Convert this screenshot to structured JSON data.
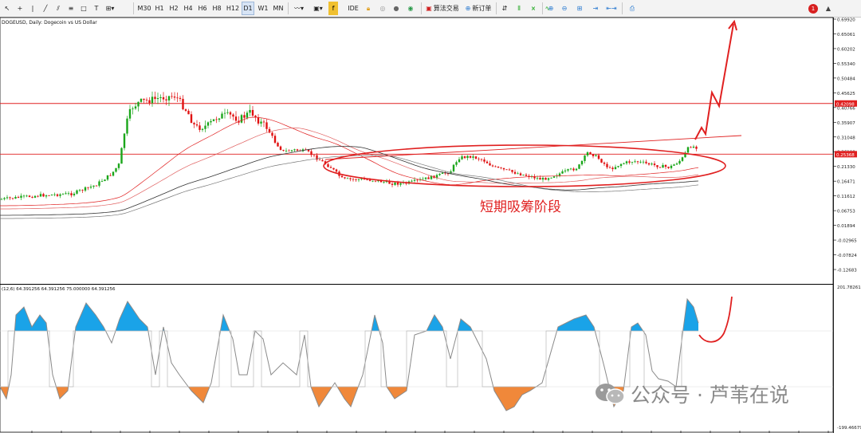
{
  "toolbar": {
    "timeframes": [
      "M30",
      "H1",
      "H2",
      "H4",
      "H6",
      "H8",
      "H12",
      "D1",
      "W1",
      "MN"
    ],
    "active_timeframe": "D1",
    "ide_label": "IDE",
    "algo_label": "算法交易",
    "new_order_label": "新订单",
    "notification_count": "1"
  },
  "chart": {
    "symbol_caption": "DOGEUSD, Daily: Dogecoin vs US Dollar",
    "annotation": "短期吸筹阶段",
    "price_labels": [
      "0.69920",
      "0.65061",
      "0.60202",
      "0.55340",
      "0.50484",
      "0.45625",
      "0.40766",
      "0.35907",
      "0.31048",
      "0.26190",
      "0.21330",
      "0.16471",
      "0.11612",
      "0.06753",
      "0.01894",
      "-0.02965",
      "-0.07824",
      "-0.12683"
    ],
    "hline_upper_label": "0.42098",
    "hline_lower_label": "0.25368",
    "colors": {
      "bull": "#1aa61a",
      "bear": "#e01010",
      "hline": "#e02020",
      "annotation": "#e02020",
      "oscillator_up": "#1aa3e8",
      "oscillator_down": "#f0883a"
    }
  },
  "indicator": {
    "caption": "(12,6) 64.391256 64.391256 75.000000 64.391256",
    "scale_top": "201.782611",
    "scale_bottom": "-199.46679"
  },
  "watermark": {
    "text": "公众号 · 芦苇在说"
  }
}
